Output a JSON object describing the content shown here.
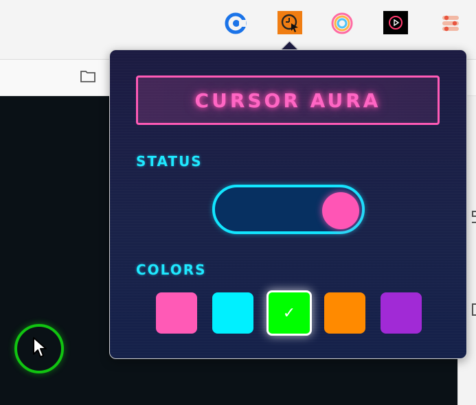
{
  "popup": {
    "title": "CURSOR AURA",
    "status_label": "STATUS",
    "status_on": true,
    "colors_label": "COLORS",
    "colors": [
      {
        "name": "pink",
        "hex": "#ff5ab6",
        "selected": false
      },
      {
        "name": "cyan",
        "hex": "#00f0ff",
        "selected": false
      },
      {
        "name": "green",
        "hex": "#00ff00",
        "selected": true
      },
      {
        "name": "orange",
        "hex": "#ff8a00",
        "selected": false
      },
      {
        "name": "purple",
        "hex": "#a12ad6",
        "selected": false
      }
    ],
    "check_glyph": "✓"
  },
  "toolbar": {
    "extension_icons": [
      "calendly-icon",
      "cursor-clock-icon",
      "rainbow-ring-icon",
      "play-circle-icon",
      "toggles-icon"
    ]
  },
  "cursor": {
    "aura_color": "#11c411"
  }
}
